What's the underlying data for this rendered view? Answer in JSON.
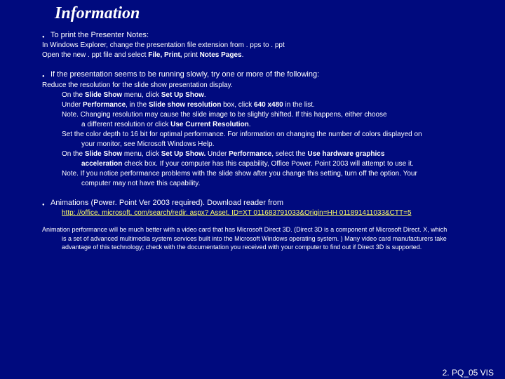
{
  "title": "Information",
  "bullet1": {
    "head": "To print the Presenter Notes:",
    "l1": "In Windows Explorer, change the presentation file extension from . pps to . ppt",
    "l2_a": "Open the new . ppt file and select ",
    "l2_b": "File, Print, ",
    "l2_c": "print ",
    "l2_d": "Notes Pages"
  },
  "bullet2": {
    "head": "If the presentation seems to be running slowly, try one or more of the following:",
    "r1": "Reduce the resolution for the slide show presentation display.",
    "r2_a": "On the ",
    "r2_b": "Slide Show",
    "r2_c": " menu, click ",
    "r2_d": "Set Up Show",
    "r3_a": "Under ",
    "r3_b": "Performance",
    "r3_c": ", in the ",
    "r3_d": "Slide show resolution",
    "r3_e": " box, click ",
    "r3_f": "640 x480",
    "r3_g": " in the list.",
    "r4": "Note.  Changing resolution may cause the slide image to be slightly shifted. If this happens, either choose",
    "r4b_a": "a different    resolution or click ",
    "r4b_b": "Use Current Resolution",
    "r5": "Set the color depth to 16 bit for optimal performance. For information on changing the number of colors displayed on",
    "r5b": "your monitor, see Microsoft Windows Help.",
    "r6_a": "On the ",
    "r6_b": "Slide Show",
    "r6_c": " menu, click ",
    "r6_d": "Set Up Show.",
    "r6_e": " Under ",
    "r6_f": "Performance",
    "r6_g": ", select the ",
    "r6_h": "Use hardware graphics",
    "r6i_a": "acceleration",
    "r6i_b": " check box. If your computer has this capability, Office Power. Point 2003 will attempt to use it.",
    "r7": "Note.  If you notice performance problems with the slide show after you change this setting, turn off the option. Your",
    "r7b": "computer may not have this capability."
  },
  "bullet3": {
    "head": "Animations (Power. Point Ver 2003 required). Download reader from",
    "url": "http: //office. microsoft. com/search/redir. aspx? Asset. ID=XT 011683791033&Origin=HH 011891411033&CTT=5"
  },
  "note": {
    "l1": "Animation performance will be much better with a video card that has Microsoft Direct 3D. (Direct 3D is a component of Microsoft Direct. X, which",
    "l2": "is a set of advanced multimedia system services built into the Microsoft Windows operating system. ) Many video card manufacturers take",
    "l3": "advantage of this technology; check with the documentation you received with your computer to find out if Direct 3D is supported."
  },
  "footer": "2. PQ_05 VIS"
}
